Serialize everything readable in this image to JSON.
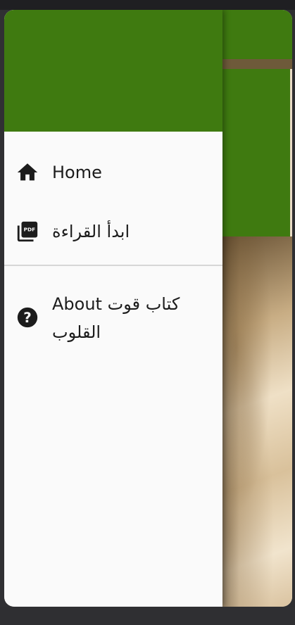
{
  "drawer": {
    "header_color": "#3f7a10",
    "items": [
      {
        "label": "Home",
        "icon": "home-icon"
      },
      {
        "label": "ابدأ القراءة",
        "icon": "pdf-library-icon"
      },
      {
        "label": "About كتاب قوت القلوب",
        "icon": "help-circle-icon"
      }
    ]
  },
  "colors": {
    "accent_green": "#3f7a10",
    "drawer_bg": "#fafafa",
    "text": "#1c1c1c"
  }
}
